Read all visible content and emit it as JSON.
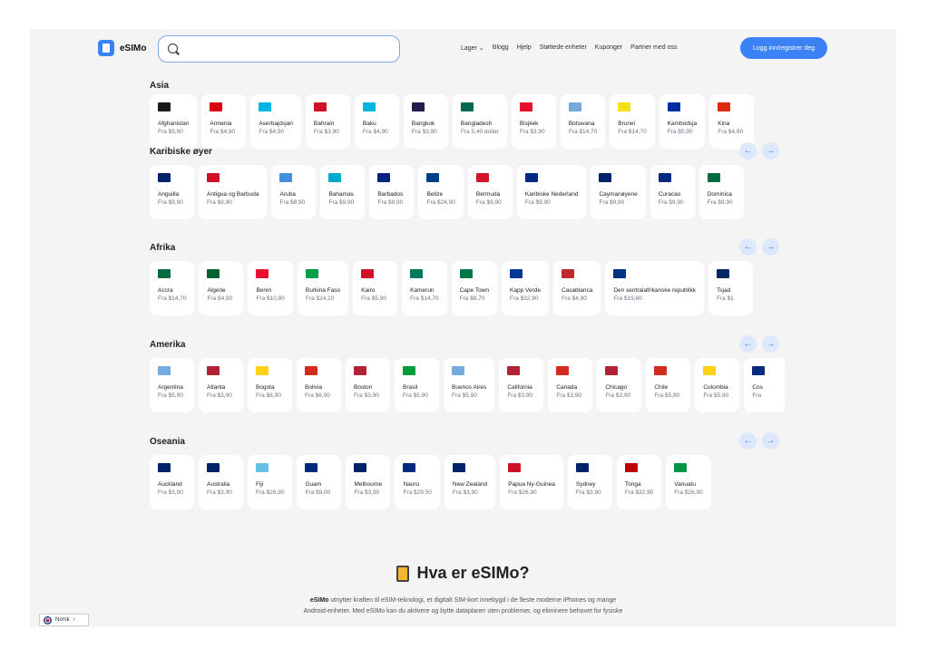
{
  "header": {
    "logo_text": "eSIMo",
    "search_placeholder": "",
    "nav": [
      "Lager",
      "Blogg",
      "Hjelp",
      "Støttede enheter",
      "Kuponger",
      "Partner med oss"
    ],
    "login": "Logg inn/registrer deg"
  },
  "regions": [
    {
      "title": "Asia",
      "items": [
        {
          "name": "Afghanistan",
          "price": "Fra $9,90",
          "color": "#1a1a1a"
        },
        {
          "name": "Armenia",
          "price": "Fra $4,90",
          "color": "#d90012"
        },
        {
          "name": "Aserbajdsjan",
          "price": "Fra $4,90",
          "color": "#00b5e2"
        },
        {
          "name": "Bahrain",
          "price": "Fra $3,90",
          "color": "#ce1126"
        },
        {
          "name": "Baku",
          "price": "Fra $4,90",
          "color": "#00b5e2"
        },
        {
          "name": "Bangkok",
          "price": "Fra $3,90",
          "color": "#241d4f"
        },
        {
          "name": "Bangladesh",
          "price": "Fra 5,40 dollar",
          "color": "#006a4e"
        },
        {
          "name": "Bisjkek",
          "price": "Fra $3,90",
          "color": "#e8112d"
        },
        {
          "name": "Botswana",
          "price": "Fra $14,70",
          "color": "#75aadb"
        },
        {
          "name": "Brunei",
          "price": "Fra $14,70",
          "color": "#f7e017"
        },
        {
          "name": "Kambodsja",
          "price": "Fra $5,90",
          "color": "#032ea1"
        },
        {
          "name": "Kina",
          "price": "Fra $4,90",
          "color": "#de2910"
        }
      ]
    },
    {
      "title": "Karibiske øyer",
      "items": [
        {
          "name": "Anguilla",
          "price": "Fra $9,90",
          "color": "#012169"
        },
        {
          "name": "Antigua og Barbuda",
          "price": "Fra $9,90",
          "color": "#ce1126"
        },
        {
          "name": "Aruba",
          "price": "Fra $8,90",
          "color": "#418fde"
        },
        {
          "name": "Bahamas",
          "price": "Fra $9,90",
          "color": "#00abc9"
        },
        {
          "name": "Barbados",
          "price": "Fra $9,90",
          "color": "#00267f"
        },
        {
          "name": "Belize",
          "price": "Fra $24,90",
          "color": "#003f87"
        },
        {
          "name": "Bermuda",
          "price": "Fra $9,90",
          "color": "#cf142b"
        },
        {
          "name": "Karibiske Nederland",
          "price": "Fra $9,90",
          "color": "#012a87"
        },
        {
          "name": "Caymanøyene",
          "price": "Fra $9,90",
          "color": "#012169"
        },
        {
          "name": "Curacao",
          "price": "Fra $9,90",
          "color": "#002b7f"
        },
        {
          "name": "Dominica",
          "price": "Fra $9,90",
          "color": "#006b3f"
        }
      ]
    },
    {
      "title": "Afrika",
      "items": [
        {
          "name": "Accra",
          "price": "Fra $14,70",
          "color": "#006b3f"
        },
        {
          "name": "Algerie",
          "price": "Fra $4,90",
          "color": "#006233"
        },
        {
          "name": "Benin",
          "price": "Fra $10,90",
          "color": "#e8112d"
        },
        {
          "name": "Burkina Faso",
          "price": "Fra $24,10",
          "color": "#009e49"
        },
        {
          "name": "Kairo",
          "price": "Fra $5,90",
          "color": "#ce1126"
        },
        {
          "name": "Kamerun",
          "price": "Fra $14,70",
          "color": "#007a5e"
        },
        {
          "name": "Cape Town",
          "price": "Fra $8,70",
          "color": "#007749"
        },
        {
          "name": "Kapp Verde",
          "price": "Fra $32,90",
          "color": "#003893"
        },
        {
          "name": "Casablanca",
          "price": "Fra $4,90",
          "color": "#c1272d"
        },
        {
          "name": "Den sentralafrikanske republikk",
          "price": "Fra $19,60",
          "color": "#003082"
        },
        {
          "name": "Tsjad",
          "price": "Fra $1",
          "color": "#002664"
        }
      ]
    },
    {
      "title": "Amerika",
      "items": [
        {
          "name": "Argentina",
          "price": "Fra $5,90",
          "color": "#74acdf"
        },
        {
          "name": "Atlanta",
          "price": "Fra $3,90",
          "color": "#b22234"
        },
        {
          "name": "Bogota",
          "price": "Fra $6,90",
          "color": "#fcd116"
        },
        {
          "name": "Bolivia",
          "price": "Fra $6,90",
          "color": "#d52b1e"
        },
        {
          "name": "Boston",
          "price": "Fra $3,90",
          "color": "#b22234"
        },
        {
          "name": "Brasil",
          "price": "Fra $5,90",
          "color": "#009c3b"
        },
        {
          "name": "Buenos Aires",
          "price": "Fra $5,90",
          "color": "#74acdf"
        },
        {
          "name": "California",
          "price": "Fra $3,90",
          "color": "#b22234"
        },
        {
          "name": "Canada",
          "price": "Fra $3,90",
          "color": "#d52b1e"
        },
        {
          "name": "Chicago",
          "price": "Fra $3,90",
          "color": "#b22234"
        },
        {
          "name": "Chile",
          "price": "Fra $5,90",
          "color": "#d52b1e"
        },
        {
          "name": "Colombia",
          "price": "Fra $5,90",
          "color": "#fcd116"
        },
        {
          "name": "Cos",
          "price": "Fra",
          "color": "#002b7f"
        }
      ]
    },
    {
      "title": "Oseania",
      "items": [
        {
          "name": "Auckland",
          "price": "Fra $3,90",
          "color": "#012169"
        },
        {
          "name": "Australia",
          "price": "Fra $3,90",
          "color": "#012169"
        },
        {
          "name": "Fiji",
          "price": "Fra $26,90",
          "color": "#68bfe5"
        },
        {
          "name": "Guam",
          "price": "Fra $9,00",
          "color": "#00297b"
        },
        {
          "name": "Melbourne",
          "price": "Fra $3,90",
          "color": "#012169"
        },
        {
          "name": "Nauru",
          "price": "Fra $29,50",
          "color": "#002b7f"
        },
        {
          "name": "New Zealand",
          "price": "Fra $3,90",
          "color": "#012169"
        },
        {
          "name": "Papua Ny-Guinea",
          "price": "Fra $26,90",
          "color": "#ce1126"
        },
        {
          "name": "Sydney",
          "price": "Fra $3,90",
          "color": "#012169"
        },
        {
          "name": "Tonga",
          "price": "Fra $32,90",
          "color": "#c10000"
        },
        {
          "name": "Vanuatu",
          "price": "Fra $26,90",
          "color": "#009543"
        }
      ]
    }
  ],
  "about": {
    "title": "Hva er eSIMo?",
    "brand": "eSIMo",
    "line1": " utnytter kraften til eSIM-teknologi, et digitalt SIM-kort innebygd i de fleste moderne iPhones og mange",
    "line2": "Android-enheter. Med eSIMo kan du aktivere og bytte dataplaner uten problemer, og eliminere behovet for fysiske"
  },
  "language": {
    "label": "Norsk",
    "chevron": "›"
  },
  "arrows": {
    "prev": "←",
    "next": "→"
  }
}
